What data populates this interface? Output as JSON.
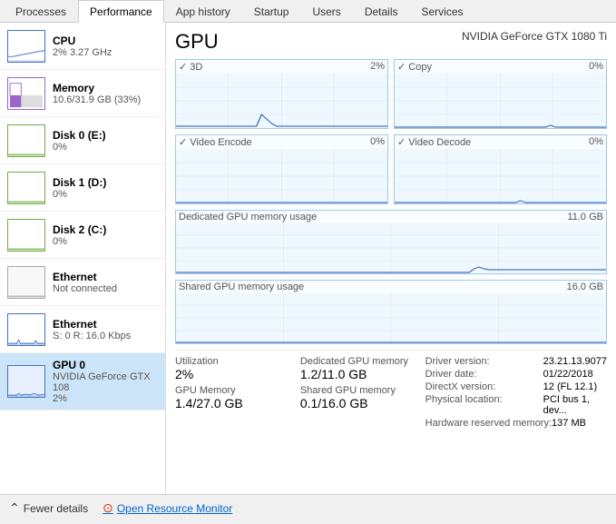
{
  "tabs": [
    {
      "id": "processes",
      "label": "Processes"
    },
    {
      "id": "performance",
      "label": "Performance",
      "active": true
    },
    {
      "id": "app-history",
      "label": "App history"
    },
    {
      "id": "startup",
      "label": "Startup"
    },
    {
      "id": "users",
      "label": "Users"
    },
    {
      "id": "details",
      "label": "Details"
    },
    {
      "id": "services",
      "label": "Services"
    }
  ],
  "sidebar": {
    "items": [
      {
        "id": "cpu",
        "title": "CPU",
        "sub": "2% 3.27 GHz",
        "color": "#4472c4",
        "type": "cpu"
      },
      {
        "id": "memory",
        "title": "Memory",
        "sub": "10.6/31.9 GB (33%)",
        "color": "#9966cc",
        "type": "memory"
      },
      {
        "id": "disk0",
        "title": "Disk 0 (E:)",
        "sub": "0%",
        "color": "#70ad47",
        "type": "disk"
      },
      {
        "id": "disk1",
        "title": "Disk 1 (D:)",
        "sub": "0%",
        "color": "#70ad47",
        "type": "disk"
      },
      {
        "id": "disk2",
        "title": "Disk 2 (C:)",
        "sub": "0%",
        "color": "#70ad47",
        "type": "disk"
      },
      {
        "id": "ethernet-nc",
        "title": "Ethernet",
        "sub": "Not connected",
        "color": "#aaa",
        "type": "ethernet-nc"
      },
      {
        "id": "ethernet",
        "title": "Ethernet",
        "sub": "S: 0 R: 16.0 Kbps",
        "color": "#4472c4",
        "type": "ethernet"
      },
      {
        "id": "gpu0",
        "title": "GPU 0",
        "sub": "NVIDIA GeForce GTX 108",
        "sub2": "2%",
        "color": "#4472c4",
        "type": "gpu",
        "selected": true
      }
    ]
  },
  "gpu": {
    "title": "GPU",
    "model": "NVIDIA GeForce GTX 1080 Ti",
    "charts": {
      "row1": [
        {
          "label": "3D",
          "pct": "2%"
        },
        {
          "label": "Copy",
          "pct": "0%"
        }
      ],
      "row2": [
        {
          "label": "Video Encode",
          "pct": "0%"
        },
        {
          "label": "Video Decode",
          "pct": "0%"
        }
      ],
      "dedicated": {
        "label": "Dedicated GPU memory usage",
        "max": "11.0 GB"
      },
      "shared": {
        "label": "Shared GPU memory usage",
        "max": "16.0 GB"
      }
    },
    "stats": {
      "utilization_label": "Utilization",
      "utilization_val": "2%",
      "gpu_memory_label": "GPU Memory",
      "gpu_memory_val": "1.4/27.0 GB",
      "dedicated_label": "Dedicated GPU memory",
      "dedicated_val": "1.2/11.0 GB",
      "shared_label": "Shared GPU memory",
      "shared_val": "0.1/16.0 GB"
    },
    "driver": {
      "version_label": "Driver version:",
      "version_val": "23.21.13.9077",
      "date_label": "Driver date:",
      "date_val": "01/22/2018",
      "directx_label": "DirectX version:",
      "directx_val": "12 (FL 12.1)",
      "location_label": "Physical location:",
      "location_val": "PCI bus 1, dev...",
      "reserved_label": "Hardware reserved memory:",
      "reserved_val": "137 MB"
    }
  },
  "bottom": {
    "fewer_label": "Fewer details",
    "monitor_label": "Open Resource Monitor"
  }
}
